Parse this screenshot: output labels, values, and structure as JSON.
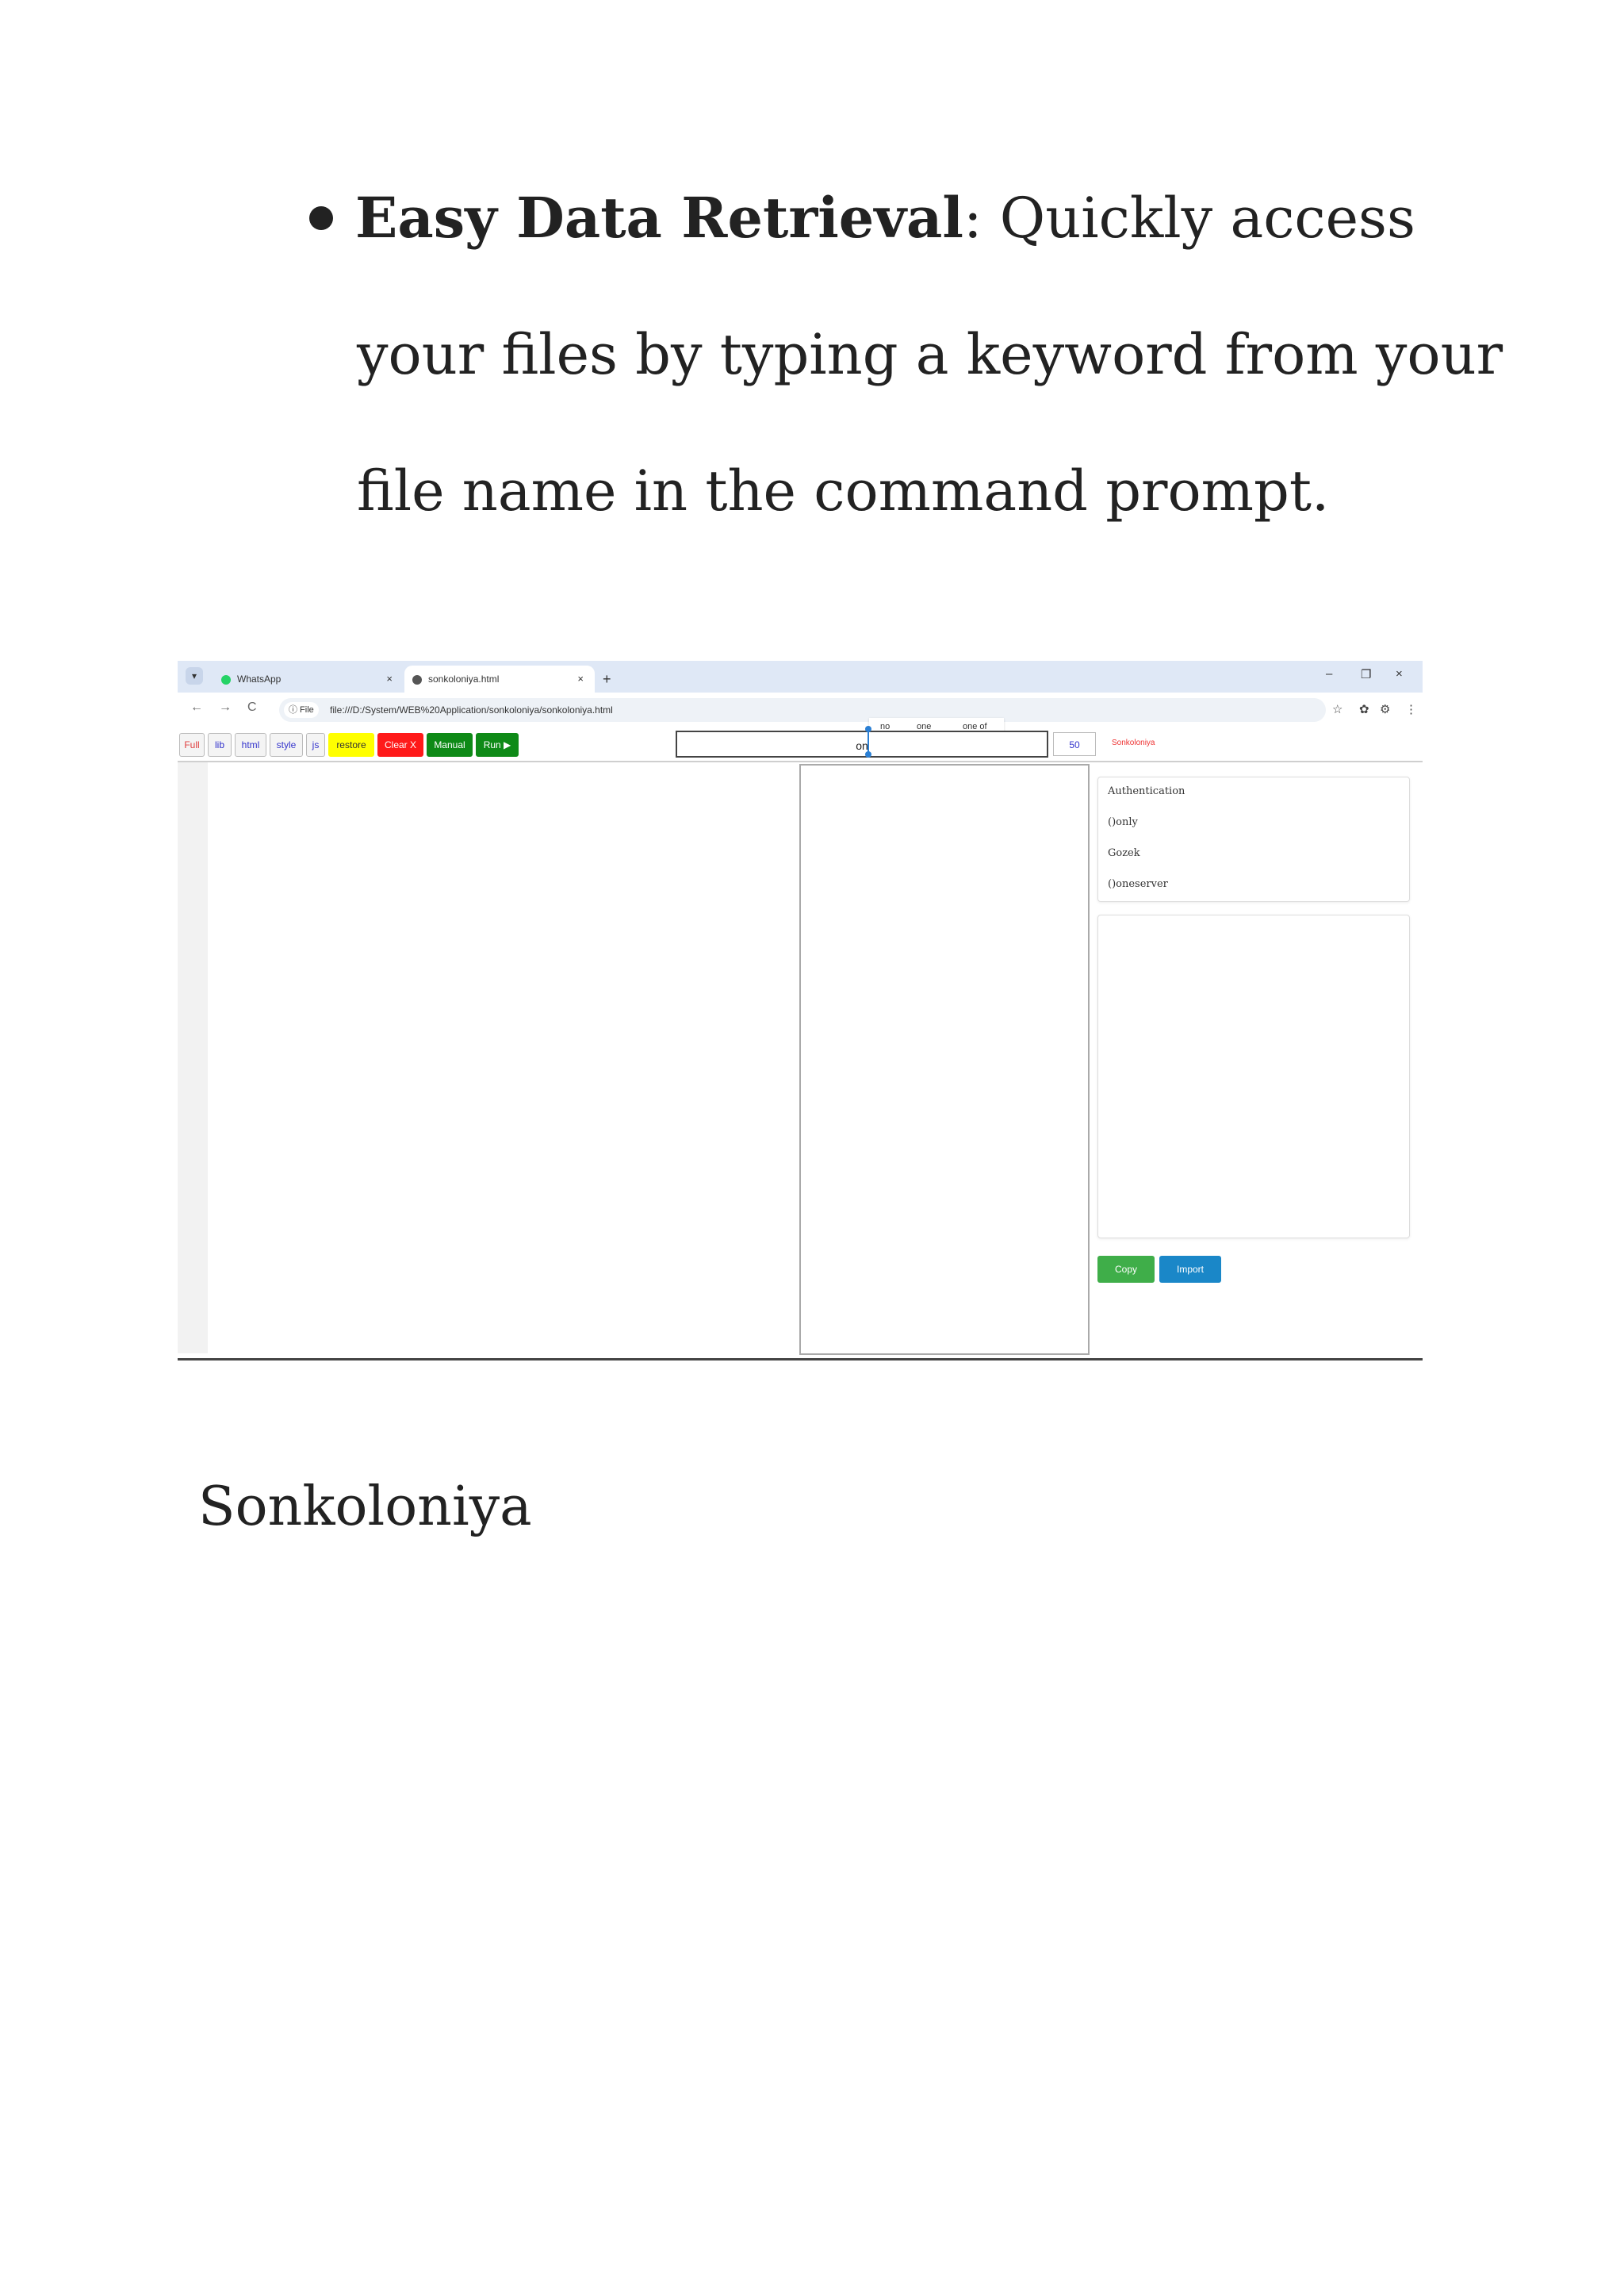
{
  "document": {
    "bullet_bold": "Easy Data Retrieval",
    "bullet_rest_1": ": Quickly access",
    "bullet_line_2": "your files by typing a keyword from your",
    "bullet_line_3": "file name in the command prompt.",
    "caption": "Sonkoloniya"
  },
  "browser": {
    "tabs": [
      {
        "label": "WhatsApp",
        "close": "×",
        "icon_color": "#25d366"
      },
      {
        "label": "sonkoloniya.html",
        "close": "×",
        "icon_color": "#555555"
      }
    ],
    "tab_dropdown": "▾",
    "new_tab": "+",
    "window_controls": [
      "–",
      "❐",
      "×"
    ],
    "nav": [
      "←",
      "→",
      "C"
    ],
    "site_chip": "ⓘ File",
    "url": "file:///D:/System/WEB%20Application/sonkoloniya/sonkoloniya.html",
    "right_icons": [
      "☆",
      "✿",
      "⚙",
      "⋮"
    ]
  },
  "app": {
    "toolbar_buttons": [
      {
        "label": "Full",
        "color": "#e04040",
        "bg": "#f4f4f4"
      },
      {
        "label": "lib",
        "color": "#3333cc",
        "bg": "#f4f4f4"
      },
      {
        "label": "html",
        "color": "#3333cc",
        "bg": "#f4f4f4"
      },
      {
        "label": "style",
        "color": "#3333cc",
        "bg": "#f4f4f4"
      },
      {
        "label": "js",
        "color": "#3333cc",
        "bg": "#f4f4f4"
      },
      {
        "label": "restore",
        "color": "#333333",
        "bg": "#ffff00"
      },
      {
        "label": "Clear X",
        "color": "#ffffff",
        "bg": "#ff1a1a"
      },
      {
        "label": "Manual",
        "color": "#ffffff",
        "bg": "#0e8a17"
      },
      {
        "label": "Run ▶",
        "color": "#ffffff",
        "bg": "#0e8a17"
      }
    ],
    "command_value": "on",
    "suggestions": [
      "no",
      "one",
      "one of"
    ],
    "limit_value": "50",
    "brand": "Sonkoloniya",
    "file_list": [
      "Authentication",
      "()only",
      "Gozek",
      "()oneserver"
    ],
    "copy_label": "Copy",
    "import_label": "Import"
  }
}
